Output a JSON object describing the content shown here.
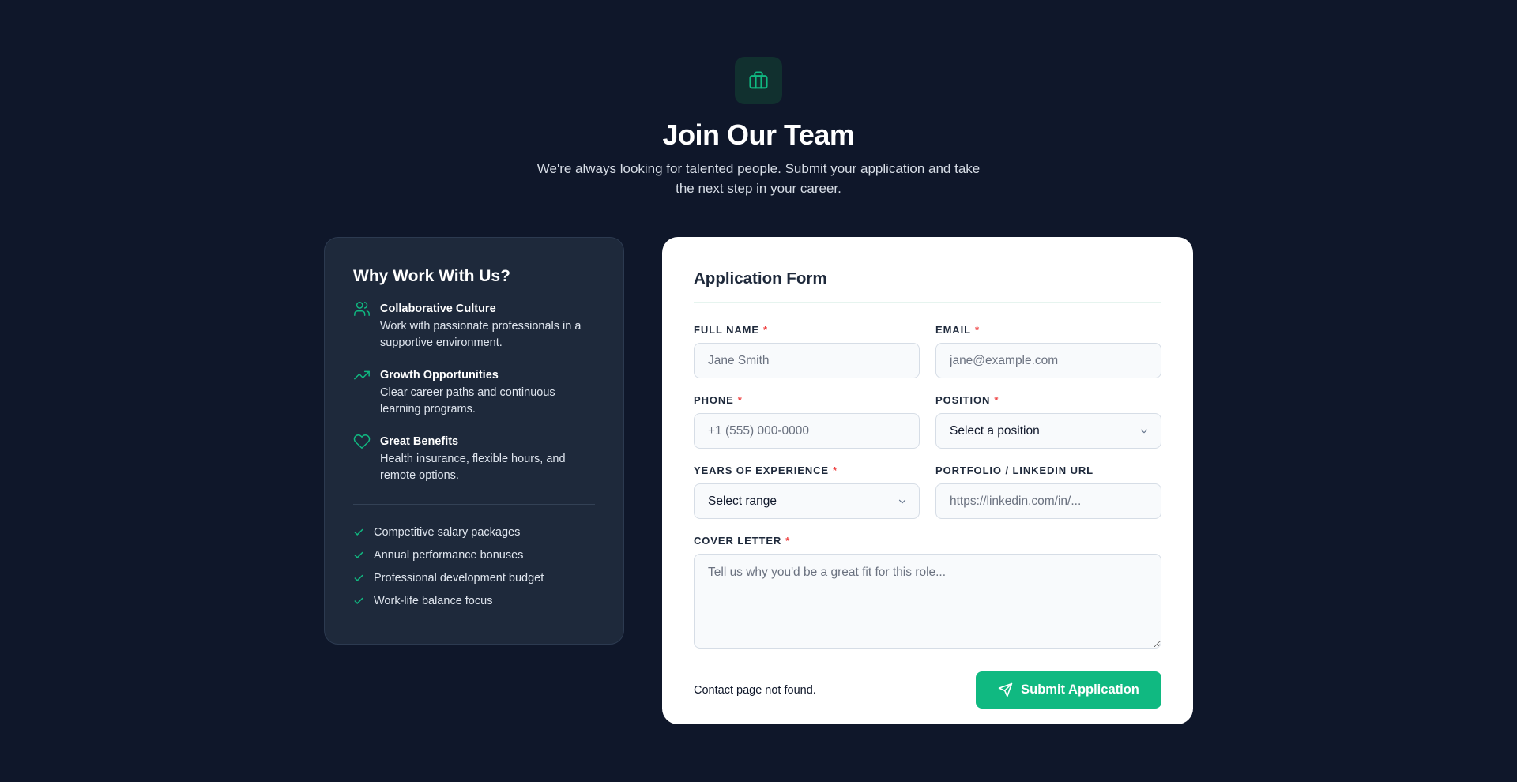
{
  "header": {
    "title": "Join Our Team",
    "subtitle": "We're always looking for talented people. Submit your application and take the next step in your career.",
    "icon": "briefcase-icon"
  },
  "why": {
    "title": "Why Work With Us?",
    "features": [
      {
        "icon": "users-icon",
        "title": "Collaborative Culture",
        "desc": "Work with passionate professionals in a supportive environment."
      },
      {
        "icon": "trending-up-icon",
        "title": "Growth Opportunities",
        "desc": "Clear career paths and continuous learning programs."
      },
      {
        "icon": "heart-icon",
        "title": "Great Benefits",
        "desc": "Health insurance, flexible hours, and remote options."
      }
    ],
    "perks": [
      "Competitive salary packages",
      "Annual performance bonuses",
      "Professional development budget",
      "Work-life balance focus"
    ]
  },
  "form": {
    "title": "Application Form",
    "full_name": {
      "label": "FULL NAME",
      "placeholder": "Jane Smith",
      "required": "*"
    },
    "email": {
      "label": "EMAIL",
      "placeholder": "jane@example.com",
      "required": "*"
    },
    "phone": {
      "label": "PHONE",
      "placeholder": "+1 (555) 000-0000",
      "required": "*"
    },
    "position": {
      "label": "POSITION",
      "value": "Select a position",
      "required": "*"
    },
    "experience": {
      "label": "YEARS OF EXPERIENCE",
      "value": "Select range",
      "required": "*"
    },
    "portfolio": {
      "label": "PORTFOLIO / LINKEDIN URL",
      "placeholder": "https://linkedin.com/in/..."
    },
    "cover_letter": {
      "label": "COVER LETTER",
      "placeholder": "Tell us why you'd be a great fit for this role...",
      "required": "*"
    },
    "status": "Contact page not found.",
    "submit_label": "Submit Application"
  },
  "colors": {
    "background": "#0f172a",
    "panel": "#1e293b",
    "accent": "#10b981",
    "required": "#ef4444"
  }
}
